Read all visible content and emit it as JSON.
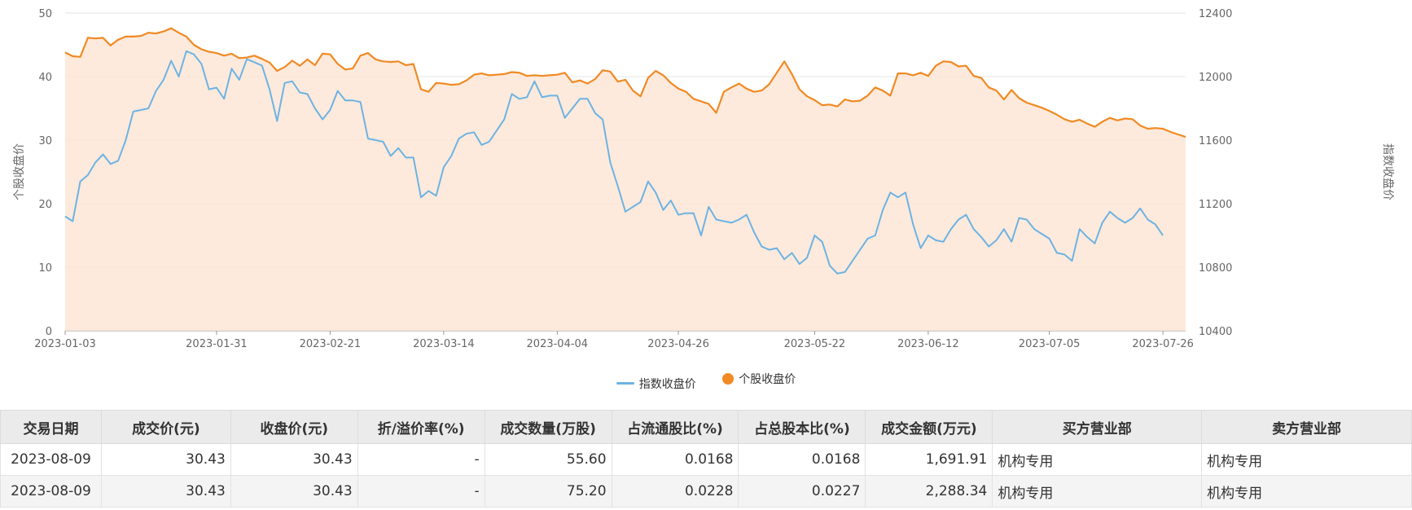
{
  "chart_data": {
    "type": "line",
    "left_axis": {
      "label": "个股收盘价",
      "ticks": [
        "50",
        "40",
        "30",
        "20",
        "10",
        "0"
      ],
      "range": [
        0,
        50
      ]
    },
    "right_axis": {
      "label": "指数收盘价",
      "ticks": [
        "12400",
        "12000",
        "11600",
        "11200",
        "10800",
        "10400"
      ],
      "range": [
        10400,
        12400
      ]
    },
    "x_tick_labels": [
      "2023-01-03",
      "2023-01-31",
      "2023-02-21",
      "2023-03-14",
      "2023-04-04",
      "2023-04-26",
      "2023-05-22",
      "2023-06-12",
      "2023-07-05",
      "2023-07-26"
    ],
    "grid": "horizontal",
    "legend": {
      "position": "bottom-center",
      "items": [
        {
          "name": "指数收盘价",
          "color": "#6db3e3",
          "marker": "line"
        },
        {
          "name": "个股收盘价",
          "color": "#f08a24",
          "marker": "dot"
        }
      ]
    },
    "colors": {
      "index_line": "#6db3e3",
      "stock_line": "#f08a24",
      "stock_area": "#fde6d6"
    },
    "series": [
      {
        "name": "个股收盘价",
        "axis": "left",
        "values": [
          43.8,
          43.2,
          43.1,
          46.1,
          46.0,
          46.1,
          44.9,
          45.8,
          46.3,
          46.3,
          46.4,
          46.9,
          46.8,
          47.1,
          47.6,
          46.9,
          46.3,
          45.0,
          44.3,
          43.9,
          43.7,
          43.3,
          43.6,
          42.9,
          43.0,
          43.3,
          42.8,
          42.2,
          40.9,
          41.5,
          42.5,
          41.7,
          42.7,
          41.8,
          43.6,
          43.5,
          42.0,
          41.1,
          41.3,
          43.3,
          43.7,
          42.7,
          42.4,
          42.3,
          42.4,
          41.8,
          42.0,
          38.0,
          37.6,
          39.0,
          38.9,
          38.7,
          38.8,
          39.4,
          40.3,
          40.5,
          40.2,
          40.3,
          40.4,
          40.7,
          40.6,
          40.1,
          40.2,
          40.1,
          40.2,
          40.3,
          40.6,
          39.1,
          39.4,
          38.9,
          39.6,
          41.0,
          40.8,
          39.2,
          39.5,
          37.8,
          36.9,
          39.8,
          40.9,
          40.2,
          39.0,
          38.1,
          37.6,
          36.5,
          36.1,
          35.7,
          34.3,
          37.6,
          38.3,
          38.9,
          38.1,
          37.6,
          37.8,
          38.8,
          40.6,
          42.4,
          40.4,
          38.0,
          36.9,
          36.3,
          35.5,
          35.6,
          35.3,
          36.4,
          36.1,
          36.2,
          37.0,
          38.3,
          37.8,
          37.0,
          40.5,
          40.5,
          40.2,
          40.6,
          40.1,
          41.7,
          42.4,
          42.3,
          41.6,
          41.7,
          40.1,
          39.8,
          38.3,
          37.8,
          36.4,
          37.9,
          36.6,
          35.9,
          35.5,
          35.1,
          34.6,
          34.0,
          33.3,
          32.9,
          33.2,
          32.6,
          32.1,
          32.9,
          33.5,
          33.1,
          33.4,
          33.3,
          32.3,
          31.8,
          31.9,
          31.8,
          31.3,
          30.9,
          30.5
        ]
      },
      {
        "name": "指数收盘价",
        "axis": "right",
        "values": [
          11120,
          11090,
          11340,
          11380,
          11460,
          11510,
          11450,
          11470,
          11600,
          11780,
          11790,
          11800,
          11910,
          11980,
          12100,
          12000,
          12160,
          12140,
          12080,
          11920,
          11930,
          11860,
          12050,
          11980,
          12110,
          12090,
          12070,
          11920,
          11720,
          11960,
          11970,
          11900,
          11890,
          11800,
          11730,
          11790,
          11910,
          11850,
          11850,
          11840,
          11610,
          11600,
          11590,
          11500,
          11550,
          11490,
          11490,
          11240,
          11280,
          11250,
          11430,
          11500,
          11610,
          11640,
          11650,
          11570,
          11590,
          11660,
          11730,
          11890,
          11860,
          11870,
          11970,
          11870,
          11880,
          11880,
          11740,
          11800,
          11860,
          11860,
          11770,
          11730,
          11460,
          11310,
          11150,
          11180,
          11210,
          11340,
          11270,
          11160,
          11220,
          11130,
          11140,
          11140,
          11000,
          11180,
          11100,
          11090,
          11080,
          11100,
          11130,
          11020,
          10930,
          10910,
          10920,
          10850,
          10890,
          10820,
          10860,
          11000,
          10960,
          10810,
          10760,
          10770,
          10840,
          10910,
          10980,
          11000,
          11160,
          11270,
          11240,
          11270,
          11070,
          10920,
          11000,
          10970,
          10960,
          11040,
          11100,
          11130,
          11040,
          10990,
          10930,
          10970,
          11040,
          10960,
          11110,
          11100,
          11040,
          11010,
          10980,
          10890,
          10880,
          10840,
          11040,
          10990,
          10950,
          11080,
          11150,
          11110,
          11080,
          11110,
          11170,
          11100,
          11070,
          11000
        ]
      }
    ]
  },
  "table": {
    "headers": [
      "交易日期",
      "成交价(元)",
      "收盘价(元)",
      "折/溢价率(%)",
      "成交数量(万股)",
      "占流通股比(%)",
      "占总股本比(%)",
      "成交金额(万元)",
      "买方营业部",
      "卖方营业部"
    ],
    "rows": [
      [
        "2023-08-09",
        "30.43",
        "30.43",
        "-",
        "55.60",
        "0.0168",
        "0.0168",
        "1,691.91",
        "机构专用",
        "机构专用"
      ],
      [
        "2023-08-09",
        "30.43",
        "30.43",
        "-",
        "75.20",
        "0.0228",
        "0.0227",
        "2,288.34",
        "机构专用",
        "机构专用"
      ]
    ]
  }
}
